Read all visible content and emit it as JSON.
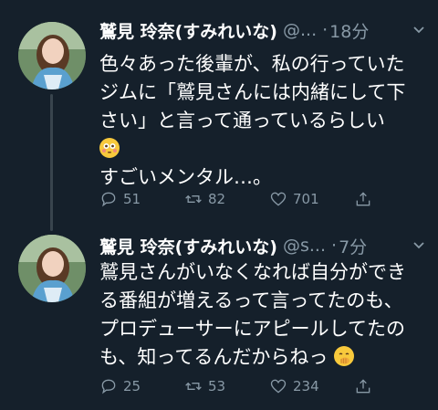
{
  "tweets": [
    {
      "name": "鷲見 玲奈(すみれいな)",
      "handle": "@...",
      "time": "18分",
      "lines": [
        "色々あった後輩が、私の行っていた",
        "ジムに「鷲見さんには内緒にして下",
        "さい」と言って通っているらしい",
        "",
        "すごいメンタル…。"
      ],
      "emoji": "flushed-face",
      "replies": "51",
      "retweets": "82",
      "likes": "701"
    },
    {
      "name": "鷲見 玲奈(すみれいな)",
      "handle": "@s...",
      "time": "7分",
      "lines": [
        "鷲見さんがいなくなれば自分ができ",
        "る番組が増えるって言ってたのも、",
        "プロデューサーにアピールしてたの",
        "も、知ってるんだからねっ"
      ],
      "emoji": "hand-over-mouth-face",
      "replies": "25",
      "retweets": "53",
      "likes": "234"
    }
  ],
  "colors": {
    "background": "#15202b",
    "muted": "#8899a6",
    "text": "#ffffff",
    "thread": "#38444d"
  }
}
